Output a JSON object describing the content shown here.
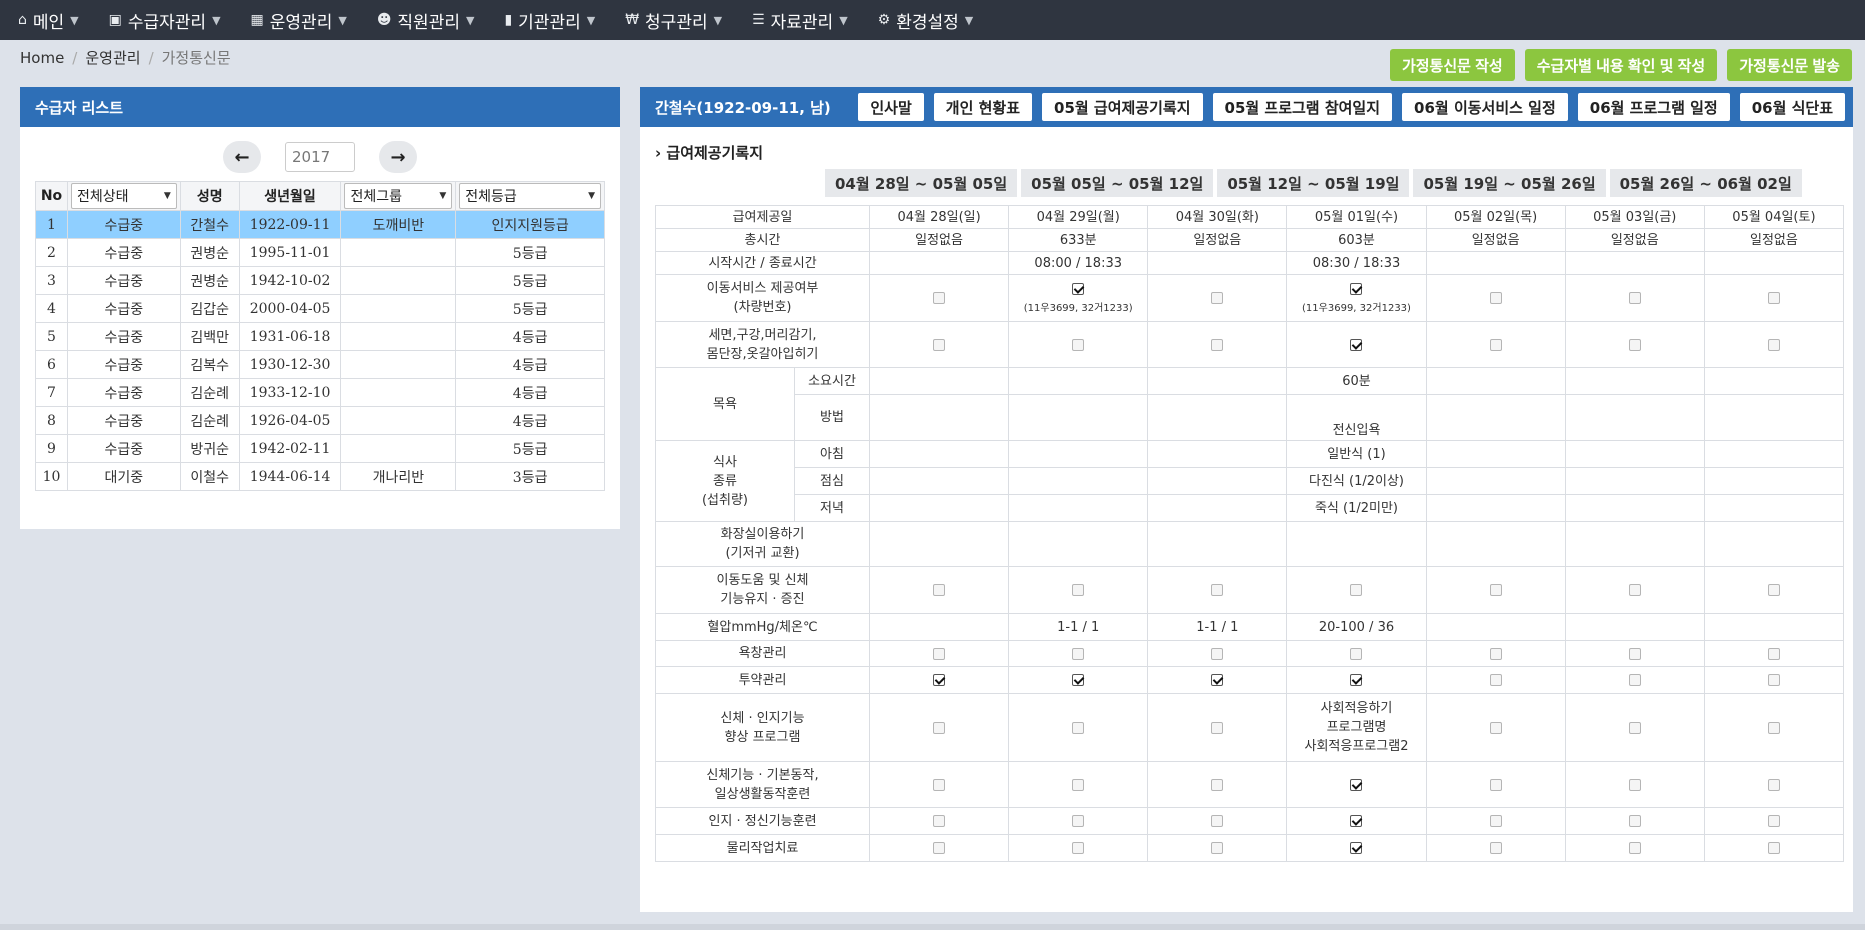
{
  "nav": [
    {
      "icon": "home-icon",
      "glyph": "⌂",
      "label": "메인"
    },
    {
      "icon": "id-card-icon",
      "glyph": "▣",
      "label": "수급자관리"
    },
    {
      "icon": "calendar-icon",
      "glyph": "▦",
      "label": "운영관리"
    },
    {
      "icon": "users-icon",
      "glyph": "☻",
      "label": "직원관리"
    },
    {
      "icon": "building-icon",
      "glyph": "▮",
      "label": "기관관리"
    },
    {
      "icon": "won-icon",
      "glyph": "₩",
      "label": "청구관리"
    },
    {
      "icon": "list-icon",
      "glyph": "☰",
      "label": "자료관리"
    },
    {
      "icon": "gear-icon",
      "glyph": "⚙",
      "label": "환경설정"
    }
  ],
  "breadcrumb": {
    "home": "Home",
    "section": "운영관리",
    "current": "가정통신문"
  },
  "actions": {
    "write": "가정통신문 작성",
    "check": "수급자별 내용 확인 및 작성",
    "send": "가정통신문 발송"
  },
  "left": {
    "title": "수급자 리스트",
    "year": "2017",
    "headers": {
      "no": "No",
      "status": "전체상태",
      "name": "성명",
      "birth": "생년월일",
      "group": "전체그룹",
      "grade": "전체등급"
    },
    "rows": [
      {
        "no": "1",
        "status": "수급중",
        "name": "간철수",
        "birth": "1922-09-11",
        "group": "도깨비반",
        "grade": "인지지원등급"
      },
      {
        "no": "2",
        "status": "수급중",
        "name": "권병순",
        "birth": "1995-11-01",
        "group": "",
        "grade": "5등급"
      },
      {
        "no": "3",
        "status": "수급중",
        "name": "권병순",
        "birth": "1942-10-02",
        "group": "",
        "grade": "5등급"
      },
      {
        "no": "4",
        "status": "수급중",
        "name": "김갑순",
        "birth": "2000-04-05",
        "group": "",
        "grade": "5등급"
      },
      {
        "no": "5",
        "status": "수급중",
        "name": "김백만",
        "birth": "1931-06-18",
        "group": "",
        "grade": "4등급"
      },
      {
        "no": "6",
        "status": "수급중",
        "name": "김복수",
        "birth": "1930-12-30",
        "group": "",
        "grade": "4등급"
      },
      {
        "no": "7",
        "status": "수급중",
        "name": "김순례",
        "birth": "1933-12-10",
        "group": "",
        "grade": "4등급"
      },
      {
        "no": "8",
        "status": "수급중",
        "name": "김순례",
        "birth": "1926-04-05",
        "group": "",
        "grade": "4등급"
      },
      {
        "no": "9",
        "status": "수급중",
        "name": "방귀순",
        "birth": "1942-02-11",
        "group": "",
        "grade": "5등급"
      },
      {
        "no": "10",
        "status": "대기중",
        "name": "이철수",
        "birth": "1944-06-14",
        "group": "개나리반",
        "grade": "3등급"
      }
    ]
  },
  "right": {
    "title": "간철수(1922-09-11, 남)",
    "buttons": [
      "인사말",
      "개인 현황표",
      "05월 급여제공기록지",
      "05월 프로그램 참여일지",
      "06월 이동서비스 일정",
      "06월 프로그램 일정",
      "06월 식단표"
    ],
    "section": "› 급여제공기록지",
    "weeks": [
      "04월 28일 ~ 05월 05일",
      "05월 05일 ~ 05월 12일",
      "05월 12일 ~ 05월 19일",
      "05월 19일 ~ 05월 26일",
      "05월 26일 ~ 06월 02일"
    ],
    "days": [
      "04월 28일(일)",
      "04월 29일(월)",
      "04월 30일(화)",
      "05월 01일(수)",
      "05월 02일(목)",
      "05월 03일(금)",
      "05월 04일(토)"
    ],
    "labels": {
      "day": "급여제공일",
      "total": "총시간",
      "time": "시작시간 / 종료시간",
      "transport1": "이동서비스 제공여부",
      "transport2": "(차량번호)",
      "wash1": "세면,구강,머리감기,",
      "wash2": "몸단장,옷갈아입히기",
      "bath": "목욕",
      "bath_time": "소요시간",
      "bath_method": "방법",
      "meal1": "식사",
      "meal2": "종류",
      "meal3": "(섭취량)",
      "breakfast": "아침",
      "lunch": "점심",
      "dinner": "저녁",
      "toilet1": "화장실이용하기",
      "toilet2": "(기저귀 교환)",
      "move1": "이동도움 및 신체",
      "move2": "기능유지 · 증진",
      "bp": "혈압mmHg/체온℃",
      "sore": "욕창관리",
      "med": "투약관리",
      "prog1": "신체 · 인지기능",
      "prog2": "향상 프로그램",
      "phys1": "신체기능 · 기본동작,",
      "phys2": "일상생활동작훈련",
      "cog": "인지 · 정신기능훈련",
      "pt": "물리작업치료"
    },
    "values": {
      "total": [
        "일정없음",
        "633분",
        "일정없음",
        "603분",
        "일정없음",
        "일정없음",
        "일정없음"
      ],
      "time": [
        "",
        "08:00 / 18:33",
        "",
        "08:30 / 18:33",
        "",
        "",
        ""
      ],
      "transport": [
        false,
        true,
        false,
        true,
        false,
        false,
        false
      ],
      "transport_note": [
        "",
        "(11우3699, 32거1233)",
        "",
        "(11우3699, 32거1233)",
        "",
        "",
        ""
      ],
      "wash": [
        false,
        false,
        false,
        true,
        false,
        false,
        false
      ],
      "bath_time": [
        "",
        "",
        "",
        "60분",
        "",
        "",
        ""
      ],
      "bath_method": [
        "",
        "",
        "",
        "전신입욕",
        "",
        "",
        ""
      ],
      "breakfast": [
        "",
        "",
        "",
        "일반식 (1)",
        "",
        "",
        ""
      ],
      "lunch": [
        "",
        "",
        "",
        "다진식 (1/2이상)",
        "",
        "",
        ""
      ],
      "dinner": [
        "",
        "",
        "",
        "죽식 (1/2미만)",
        "",
        "",
        ""
      ],
      "move": [
        false,
        false,
        false,
        false,
        false,
        false,
        false
      ],
      "bp": [
        "",
        "1-1 / 1",
        "1-1 / 1",
        "20-100 / 36",
        "",
        "",
        ""
      ],
      "sore": [
        false,
        false,
        false,
        false,
        false,
        false,
        false
      ],
      "med": [
        true,
        true,
        true,
        true,
        false,
        false,
        false
      ],
      "prog": [
        false,
        false,
        false,
        null,
        false,
        false,
        false
      ],
      "prog_text": [
        "사회적응하기",
        "프로그램명",
        "사회적응프로그램2"
      ],
      "phys": [
        false,
        false,
        false,
        true,
        false,
        false,
        false
      ],
      "cog": [
        false,
        false,
        false,
        true,
        false,
        false,
        false
      ],
      "pt": [
        false,
        false,
        false,
        true,
        false,
        false,
        false
      ]
    }
  }
}
